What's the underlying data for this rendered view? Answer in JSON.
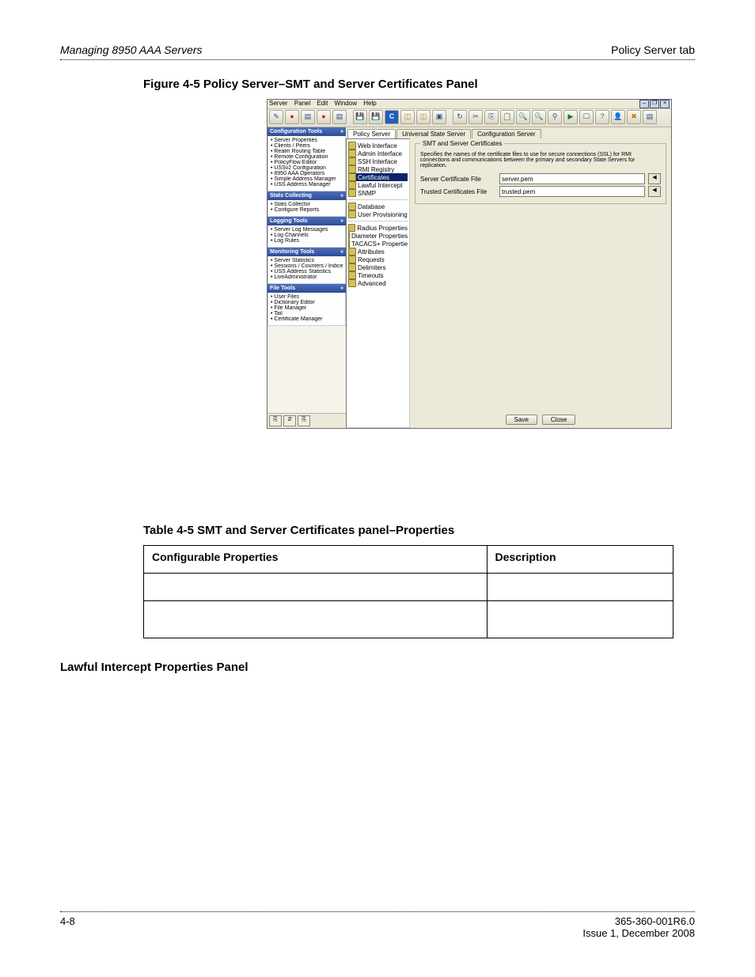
{
  "header": {
    "left": "Managing 8950 AAA Servers",
    "right": "Policy Server tab"
  },
  "figure_caption": "Figure 4-5   Policy Server–SMT and Server Certificates Panel",
  "table_caption": "Table 4-5   SMT and Server Certificates panel–Properties",
  "section_heading": "Lawful Intercept Properties Panel",
  "table": {
    "headers": [
      "Configurable Properties",
      "Description"
    ],
    "rows": [
      [
        "",
        ""
      ],
      [
        "",
        ""
      ]
    ]
  },
  "footer": {
    "page": "4-8",
    "docnum": "365-360-001R6.0",
    "issue": "Issue 1, December 2008"
  },
  "screenshot": {
    "menu": [
      "Server",
      "Panel",
      "Edit",
      "Window",
      "Help"
    ],
    "window_buttons": [
      "–",
      "❐",
      "×"
    ],
    "toolbar_icons": [
      "wand-icon",
      "record-red-icon",
      "doc-icon",
      "record-red-icon",
      "doc-icon",
      "save-icon",
      "floppy-icon",
      "refresh-blue-icon",
      "db-icon",
      "db-icon",
      "srv-icon",
      "reload-icon",
      "cut-icon",
      "copy-icon",
      "paste-icon",
      "zoom-in-icon",
      "zoom-out-icon",
      "search-icon",
      "go-icon",
      "monitor-icon",
      "help-icon",
      "user-icon",
      "wrench-icon",
      "list-icon"
    ],
    "sidebar": {
      "groups": [
        {
          "title": "Configuration Tools",
          "items": [
            "• Server Properties",
            "• Clients / Peers",
            "• Realm Routing Table",
            "• Remote Configuration",
            "• PolicyFlow Editor",
            "• USSv2 Configuration",
            "• 8950 AAA Operators",
            "• Simple Address Manager",
            "• USS Address Manager"
          ]
        },
        {
          "title": "Stats Collecting",
          "items": [
            "• Stats Collector",
            "• Configure Reports"
          ]
        },
        {
          "title": "Logging Tools",
          "items": [
            "• Server Log Messages",
            "• Log Channels",
            "• Log Rules"
          ]
        },
        {
          "title": "Monitoring Tools",
          "items": [
            "• Server Statistics",
            "• Sessions / Counters / Indices",
            "• USS Address Statistics",
            "• LiveAdministrator"
          ]
        },
        {
          "title": "File Tools",
          "items": [
            "• User Files",
            "• Dictionary Editor",
            "• File Manager",
            "• Tail",
            "• Certificate Manager"
          ]
        }
      ]
    },
    "tree": [
      "Web Interface",
      "Admin Interface",
      "SSH Interface",
      "RMI Registry",
      "Certificates",
      "Lawful Intercept",
      "SNMP",
      "",
      "Database",
      "User Provisioning",
      "",
      "Radius Properties",
      "Diameter Properties",
      "TACACS+ Properties",
      "Attributes",
      "Requests",
      "Delimiters",
      "Timeouts",
      "Advanced"
    ],
    "tree_selected": "Certificates",
    "tabs": [
      "Policy Server",
      "Universal State Server",
      "Configuration Server"
    ],
    "active_tab": 0,
    "panel": {
      "legend": "SMT and Server Certificates",
      "description": "Specifies the names of the certificate files to use for secure connections (SSL) for RMI connections and communications between the primary and secondary State Servers for replication.",
      "fields": [
        {
          "label": "Server Certificate File",
          "value": "server.pem"
        },
        {
          "label": "Trusted Certificates File",
          "value": "trusted.pem"
        }
      ]
    },
    "buttons": {
      "save": "Save",
      "close": "Close"
    },
    "status_buttons": [
      "⎘",
      "⇵",
      "⎘"
    ]
  }
}
